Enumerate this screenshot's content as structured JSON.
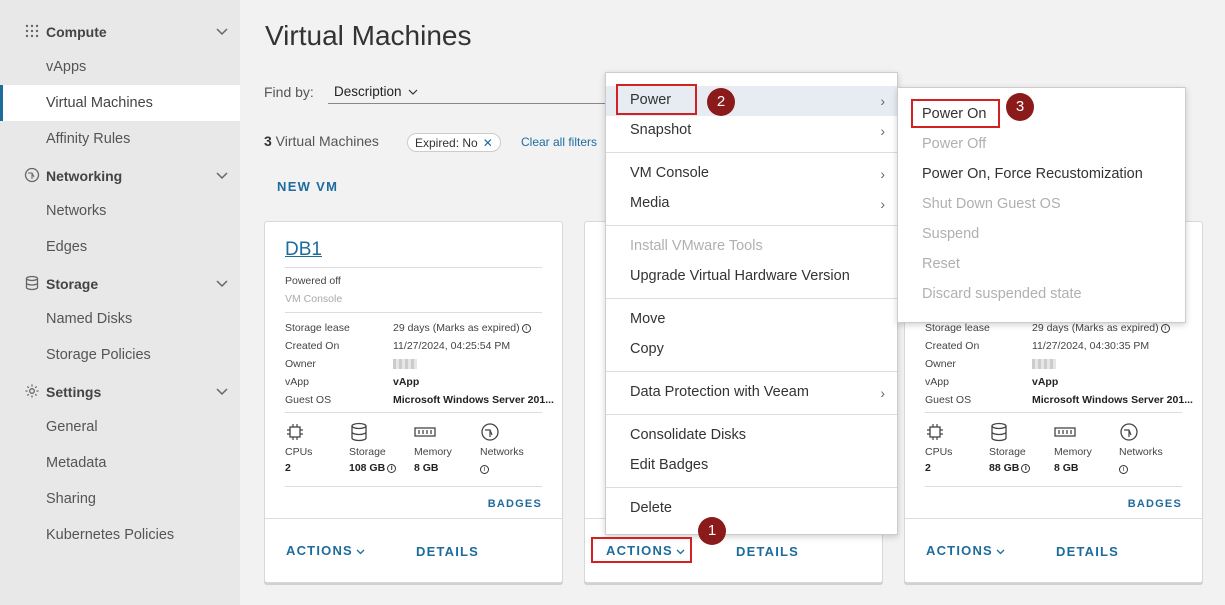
{
  "sidebar": {
    "compute": "Compute",
    "vapps": "vApps",
    "virtual_machines": "Virtual Machines",
    "affinity": "Affinity Rules",
    "networking": "Networking",
    "networks": "Networks",
    "edges": "Edges",
    "storage": "Storage",
    "named_disks": "Named Disks",
    "storage_policies": "Storage Policies",
    "settings": "Settings",
    "general": "General",
    "metadata": "Metadata",
    "sharing": "Sharing",
    "k8s": "Kubernetes Policies"
  },
  "header": {
    "title": "Virtual Machines",
    "find_by": "Find by:",
    "find_value": "Description",
    "count_num": "3",
    "count_label": " Virtual Machines",
    "chip_label": "Expired:",
    "chip_value": "No",
    "clear": "Clear all filters",
    "new_vm": "NEW VM"
  },
  "card1": {
    "name": "DB1",
    "status": "Powered off",
    "console": "VM Console",
    "storage_lease_l": "Storage lease",
    "storage_lease_v": "29 days (Marks as expired)",
    "created_l": "Created On",
    "created_v": "11/27/2024, 04:25:54 PM",
    "owner_l": "Owner",
    "vapp_l": "vApp",
    "vapp_v": "vApp",
    "os_l": "Guest OS",
    "os_v": "Microsoft Windows Server 201...",
    "cpus_l": "CPUs",
    "cpus_v": "2",
    "storage_l": "Storage",
    "storage_v": "108 GB",
    "mem_l": "Memory",
    "mem_v": "8 GB",
    "net_l": "Networks",
    "badges": "BADGES",
    "actions": "ACTIONS",
    "details": "DETAILS"
  },
  "card2": {
    "actions": "ACTIONS",
    "details": "DETAILS"
  },
  "card3": {
    "storage_lease_l": "Storage lease",
    "storage_lease_v": "29 days (Marks as expired)",
    "created_l": "Created On",
    "created_v": "11/27/2024, 04:30:35 PM",
    "owner_l": "Owner",
    "vapp_l": "vApp",
    "vapp_v": "vApp",
    "os_l": "Guest OS",
    "os_v": "Microsoft Windows Server 201...",
    "cpus_l": "CPUs",
    "cpus_v": "2",
    "storage_l": "Storage",
    "storage_v": "88 GB",
    "mem_l": "Memory",
    "mem_v": "8 GB",
    "net_l": "Networks",
    "badges": "BADGES",
    "actions": "ACTIONS",
    "details": "DETAILS"
  },
  "actions_menu": {
    "power": "Power",
    "snapshot": "Snapshot",
    "vm_console": "VM Console",
    "media": "Media",
    "install_tools": "Install VMware Tools",
    "upgrade_hw": "Upgrade Virtual Hardware Version",
    "move": "Move",
    "copy": "Copy",
    "data_protection": "Data Protection with Veeam",
    "consolidate": "Consolidate Disks",
    "edit_badges": "Edit Badges",
    "delete": "Delete"
  },
  "power_menu": {
    "power_on": "Power On",
    "power_off": "Power Off",
    "power_on_force": "Power On, Force Recustomization",
    "shutdown": "Shut Down Guest OS",
    "suspend": "Suspend",
    "reset": "Reset",
    "discard": "Discard suspended state"
  },
  "callouts": {
    "one": "1",
    "two": "2",
    "three": "3"
  },
  "colors": {
    "accent": "#1e6b9e",
    "callout": "#8b1a1a",
    "highlight_border": "#d32020"
  }
}
